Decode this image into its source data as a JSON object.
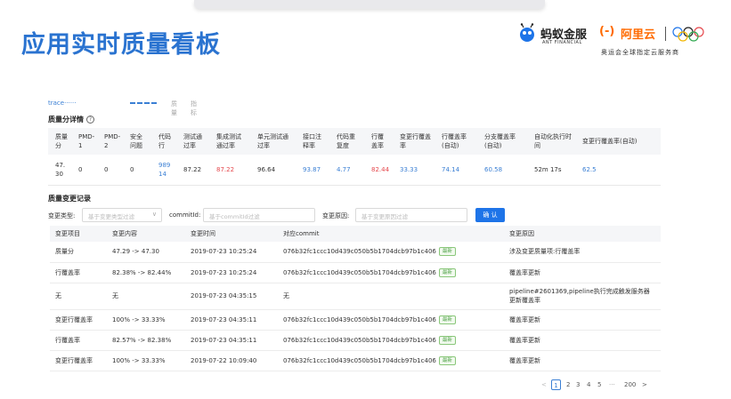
{
  "slide": {
    "title": "应用实时质量看板"
  },
  "logos": {
    "ant_name": "蚂蚁金服",
    "ant_sub": "ANT FINANCIAL",
    "aliyun_mark": "(-)",
    "aliyun_name": "阿里云",
    "olympic_caption": "奥运会全球指定云服务商"
  },
  "colors": {
    "title_blue": "#2a73d0",
    "accent_blue": "#3a7fd4",
    "red": "#e5484d",
    "tag_green": "#52a34a",
    "button_blue": "#1e74e8",
    "aliyun_orange": "#ff6a00"
  },
  "nav": {
    "brand": "trace······",
    "tab_a": "质量",
    "tab_b": "指标"
  },
  "quality_detail": {
    "title": "质量分详情",
    "help_icon": "?",
    "headers": [
      "质量分",
      "PMD-1",
      "PMD-2",
      "安全问题",
      "代码行",
      "测试通过率",
      "集成测试通过率",
      "单元测试通过率",
      "接口注释率",
      "代码重复度",
      "行覆盖率",
      "变更行覆盖率",
      "行覆盖率(自动)",
      "分支覆盖率(自动)",
      "自动化执行时间",
      "变更行覆盖率(自动)"
    ],
    "values": [
      "47.30",
      "0",
      "0",
      "0",
      "98914",
      "87.22",
      "87.22",
      "96.64",
      "93.87",
      "4.77",
      "82.44",
      "33.33",
      "74.14",
      "60.58",
      "52m 17s",
      "62.5"
    ]
  },
  "change_record": {
    "title": "质量变更记录",
    "filter": {
      "type_label": "变更类型:",
      "type_placeholder": "基于变更类型过滤",
      "commit_label": "commitId:",
      "commit_placeholder": "基于commitId过滤",
      "reason_label": "变更原因:",
      "reason_placeholder": "基于变更原因过滤",
      "confirm": "确 认"
    },
    "headers": [
      "变更项目",
      "变更内容",
      "变更时间",
      "对应commit",
      "变更原因"
    ],
    "latest_tag": "最新",
    "rows": [
      {
        "item": "质量分",
        "content": "47.29 -> 47.30",
        "time": "2019-07-23 10:25:24",
        "commit": "076b32fc1ccc10d439c050b5b1704dcb97b1c406",
        "latest": true,
        "reason": "涉及变更质量项:行覆盖率"
      },
      {
        "item": "行覆盖率",
        "content": "82.38% -> 82.44%",
        "time": "2019-07-23 10:25:24",
        "commit": "076b32fc1ccc10d439c050b5b1704dcb97b1c406",
        "latest": true,
        "reason": "覆盖率更新"
      },
      {
        "item": "无",
        "content": "无",
        "time": "2019-07-23 04:35:15",
        "commit": "无",
        "latest": false,
        "reason": "pipeline#2601369,pipeline执行完成触发服务器更新覆盖率"
      },
      {
        "item": "变更行覆盖率",
        "content": "100% -> 33.33%",
        "time": "2019-07-23 04:35:11",
        "commit": "076b32fc1ccc10d439c050b5b1704dcb97b1c406",
        "latest": true,
        "reason": "覆盖率更新"
      },
      {
        "item": "行覆盖率",
        "content": "82.57% -> 82.38%",
        "time": "2019-07-23 04:35:11",
        "commit": "076b32fc1ccc10d439c050b5b1704dcb97b1c406",
        "latest": true,
        "reason": "覆盖率更新"
      },
      {
        "item": "变更行覆盖率",
        "content": "100% -> 33.33%",
        "time": "2019-07-22 10:09:40",
        "commit": "076b32fc1ccc10d439c050b5b1704dcb97b1c406",
        "latest": true,
        "reason": "覆盖率更新"
      }
    ]
  },
  "pagination": {
    "prev": "<",
    "pages": [
      "1",
      "2",
      "3",
      "4",
      "5"
    ],
    "current": "1",
    "ellipsis": "···",
    "last": "200",
    "next": ">"
  }
}
